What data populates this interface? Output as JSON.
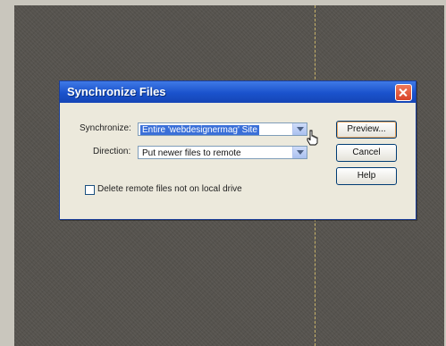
{
  "dialog": {
    "title": "Synchronize Files",
    "synchronize_label": "Synchronize:",
    "synchronize_value": "Entire 'webdesignermag' Site",
    "direction_label": "Direction:",
    "direction_value": "Put newer files to remote",
    "delete_checkbox_label": "Delete remote files not on local drive",
    "delete_checkbox_checked": false,
    "buttons": {
      "preview": "Preview...",
      "cancel": "Cancel",
      "help": "Help"
    }
  },
  "icons": {
    "close": "close-icon",
    "dropdown": "chevron-down-icon",
    "cursor": "hand-pointer-icon"
  },
  "colors": {
    "titlebar": "#1a52cc",
    "dialog_bg": "#ece9dc",
    "close_button": "#d8442a",
    "selection": "#3a6fd8",
    "background": "#56534e"
  }
}
